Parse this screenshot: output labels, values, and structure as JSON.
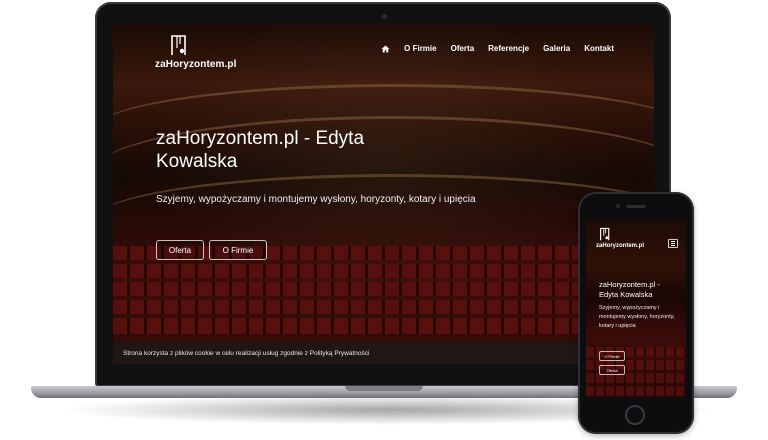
{
  "site": {
    "logo_text": "zaHoryzontem.pl",
    "nav": {
      "items": [
        "O Firmie",
        "Oferta",
        "Referencje",
        "Galeria",
        "Kontakt"
      ]
    },
    "hero": {
      "title": "zaHoryzontem.pl - Edyta Kowalska",
      "subtitle": "Szyjemy, wypożyczamy i montujemy wysłony, horyzonty, kotary i upięcia",
      "buttons": [
        "Oferta",
        "O Firmie"
      ]
    },
    "cookie_notice": "Strona korzysta z plików cookie w celu realizacji usług zgodnie z Polityką Prywatności"
  },
  "mobile": {
    "logo_text": "zaHoryzontem.pl",
    "title_line1": "zaHoryzontem.pl -",
    "title_line2": "Edyta Kowalska",
    "subtitle": "Szyjemy, wypożyczamy i montujemy wysłony, horyzonty, kotary i upięcia",
    "buttons": [
      "O Firmie",
      "Oferta"
    ]
  },
  "colors": {
    "accent_seat_red": "#8e1a16",
    "nav_text": "#ffffff",
    "cookie_bar": "#1e1818"
  },
  "icons": {
    "nav_home": "home-icon",
    "logo": "theatre-curtain-logo-icon",
    "mobile_menu": "hamburger-menu-icon"
  }
}
